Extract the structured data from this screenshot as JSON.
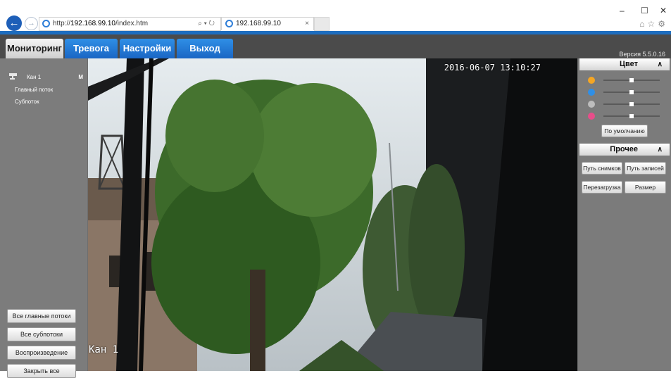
{
  "browser": {
    "address_prefix": "http://",
    "address_host": "192.168.99.10",
    "address_path": "/index.htm",
    "address_tools": "⌕ ▾ ↻",
    "tab_title": "192.168.99.10",
    "tab_close": "×",
    "back_glyph": "←",
    "forward_glyph": "→",
    "minimize": "–",
    "maximize": "☐",
    "close": "✕",
    "toolbar_icons": "⌂☆⚙"
  },
  "nav": {
    "tabs": [
      "Мониторинг",
      "Тревога",
      "Настройки",
      "Выход"
    ],
    "active_tab": "Мониторинг",
    "version": "Версия 5.5.0.16"
  },
  "sidebar": {
    "channel": "Кан 1",
    "channel_flag": "M",
    "streams": [
      "Главный поток",
      "Субпоток"
    ],
    "buttons": [
      "Все главные потоки",
      "Все субпотоки",
      "Воспроизведение",
      "Закрыть все"
    ]
  },
  "video": {
    "timestamp": "2016-06-07 13:10:27",
    "channel_label": "Кан 1"
  },
  "color_panel": {
    "title": "Цвет",
    "collapse_glyph": "∧",
    "sliders": [
      {
        "icon": "brightness-icon",
        "color": "#f5a623",
        "value": 0.5
      },
      {
        "icon": "contrast-icon",
        "color": "#2f8fe6",
        "value": 0.5
      },
      {
        "icon": "saturation-icon",
        "color": "#bdbdbd",
        "value": 0.5
      },
      {
        "icon": "hue-icon",
        "color": "#e84d8a",
        "value": 0.5
      }
    ],
    "default_button": "По умолчанию"
  },
  "other_panel": {
    "title": "Прочее",
    "collapse_glyph": "∧",
    "buttons": [
      "Путь снимков",
      "Путь записей",
      "Перезагрузка",
      "Размер"
    ]
  },
  "colors": {
    "accent": "#1d6dbf",
    "nav_tab": "#2a7fd8",
    "panel": "#7b7b7b"
  }
}
